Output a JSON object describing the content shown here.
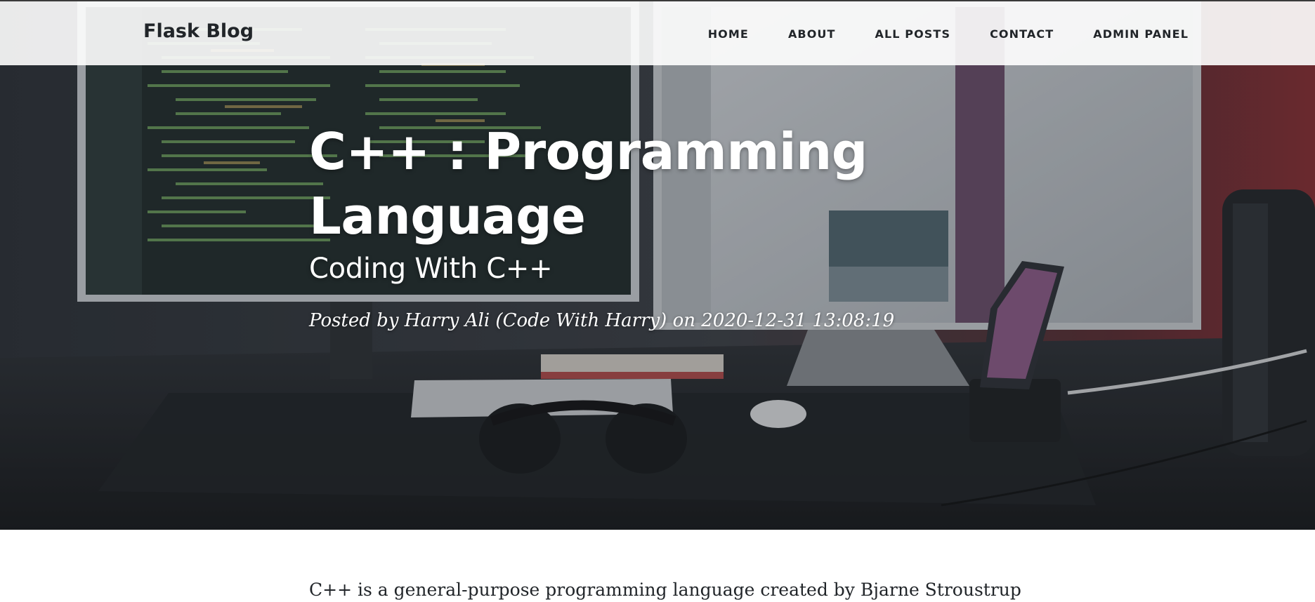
{
  "navbar": {
    "brand": "Flask Blog",
    "links": [
      "HOME",
      "ABOUT",
      "ALL POSTS",
      "CONTACT",
      "ADMIN PANEL"
    ]
  },
  "post": {
    "title_line1": "C++ : Programming",
    "title_line2": "Language",
    "subtitle": "Coding With C++",
    "meta": "Posted by Harry Ali (Code With Harry) on 2020-12-31 13:08:19",
    "body_first_line": "C++ is a general-purpose programming language created by Bjarne Stroustrup"
  },
  "colors": {
    "text_dark": "#212529",
    "navbar_bg": "#f2f2f2",
    "hero_overlay": "#212529",
    "white": "#ffffff"
  }
}
